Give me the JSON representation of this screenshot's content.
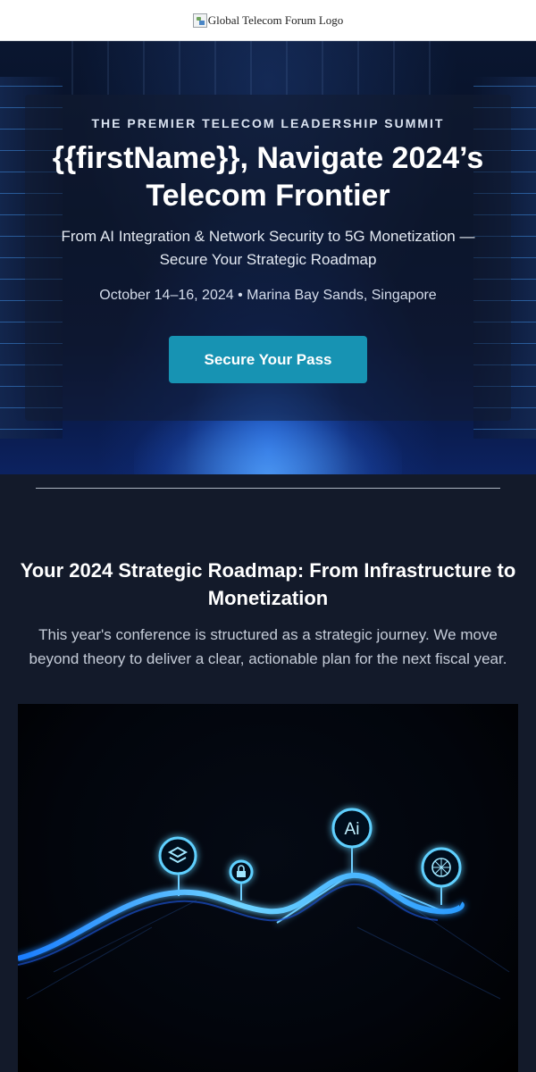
{
  "header": {
    "logo_alt": "Global Telecom Forum Logo"
  },
  "hero": {
    "kicker": "THE PREMIER TELECOM LEADERSHIP SUMMIT",
    "title": "{{firstName}}, Navigate 2024’s Telecom Frontier",
    "subtitle": "From AI Integration & Network Security to 5G Monetization — Secure Your Strategic Roadmap",
    "date_location": "October 14–16, 2024 • Marina Bay Sands, Singapore",
    "cta_label": "Secure Your Pass"
  },
  "roadmap": {
    "heading": "Your 2024 Strategic Roadmap: From Infrastructure to Monetization",
    "body": "This year's conference is structured as a strategic journey. We move beyond theory to deliver a clear, actionable plan for the next fiscal year.",
    "ai_badge_text": "Ai",
    "icons": [
      "layers-icon",
      "lock-icon",
      "ai-icon",
      "globe-icon"
    ]
  },
  "colors": {
    "accent": "#1793b3",
    "background": "#131a2a",
    "glow": "#38b6ff"
  }
}
